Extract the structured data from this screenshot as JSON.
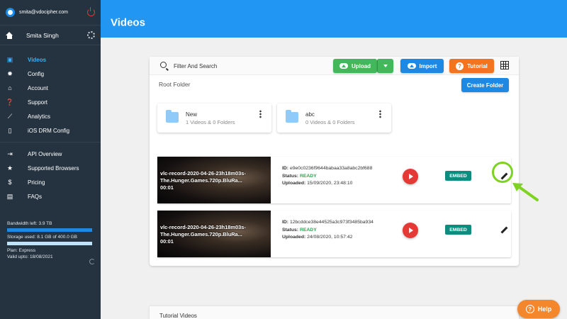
{
  "sidebar": {
    "email": "smita@vdocipher.com",
    "username": "Smita Singh",
    "nav_main": [
      {
        "label": "Videos",
        "icon": "video-library-icon",
        "active": true
      },
      {
        "label": "Config",
        "icon": "gear-icon",
        "active": false
      },
      {
        "label": "Account",
        "icon": "bank-icon",
        "active": false
      },
      {
        "label": "Support",
        "icon": "help-circle-icon",
        "active": false
      },
      {
        "label": "Analytics",
        "icon": "trend-line-icon",
        "active": false
      },
      {
        "label": "iOS DRM Config",
        "icon": "mobile-phone-icon",
        "active": false
      }
    ],
    "nav_secondary": [
      {
        "label": "API Overview",
        "icon": "login-icon"
      },
      {
        "label": "Supported Browsers",
        "icon": "star-icon"
      },
      {
        "label": "Pricing",
        "icon": "dollar-icon"
      },
      {
        "label": "FAQs",
        "icon": "chat-icon"
      }
    ],
    "usage": {
      "bandwidth": "Bandwidth left: 3.9 TB",
      "bandwidth_fraction": 1.0,
      "storage": "Storage used: 8.1 GB of 400.0 GB",
      "storage_fraction": 1.0,
      "plan": "Plan: Express",
      "valid": "Valid upto: 18/08/2021"
    }
  },
  "header": {
    "title": "Videos"
  },
  "toolbar": {
    "search_placeholder": "Filter And Search",
    "upload_label": "Upload",
    "import_label": "Import",
    "tutorial_label": "Tutorial"
  },
  "folder_section": {
    "title": "Root Folder",
    "create_label": "Create Folder",
    "folders": [
      {
        "name": "New",
        "meta": "1 Videos & 0 Folders"
      },
      {
        "name": "abc",
        "meta": "0 Videos & 0 Folders"
      }
    ]
  },
  "videos": [
    {
      "thumb_title": "vlc-record-2020-04-26-23h18m03s-The.Hunger.Games.720p.BluRa...",
      "duration": "00:01",
      "id_label": "ID:",
      "id": "e9e0c0236f9644babaa33a8abc2bf688",
      "status_label": "Status:",
      "status": "READY",
      "uploaded_label": "Uploaded:",
      "uploaded": "15/09/2020, 23:48:10",
      "embed_label": "EMBED"
    },
    {
      "thumb_title": "vlc-record-2020-04-26-23h18m03s-The.Hunger.Games.720p.BluRa...",
      "duration": "00:01",
      "id_label": "ID:",
      "id": "12bcddce38e44525a3c973f3485ba934",
      "status_label": "Status:",
      "status": "READY",
      "uploaded_label": "Uploaded:",
      "uploaded": "24/08/2020, 10:57:42",
      "embed_label": "EMBED"
    }
  ],
  "tutorial_panel": {
    "title": "Tutorial Videos"
  },
  "help": {
    "label": "Help"
  },
  "colors": {
    "header": "#2196f3",
    "sidebar": "#253340",
    "active_nav": "#3ab0f5",
    "upload": "#43b85a",
    "import": "#1e88e5",
    "tutorial": "#f4731e",
    "embed": "#0f8c80",
    "play": "#e53935",
    "highlight": "#7ed321",
    "help": "#f4862b"
  }
}
